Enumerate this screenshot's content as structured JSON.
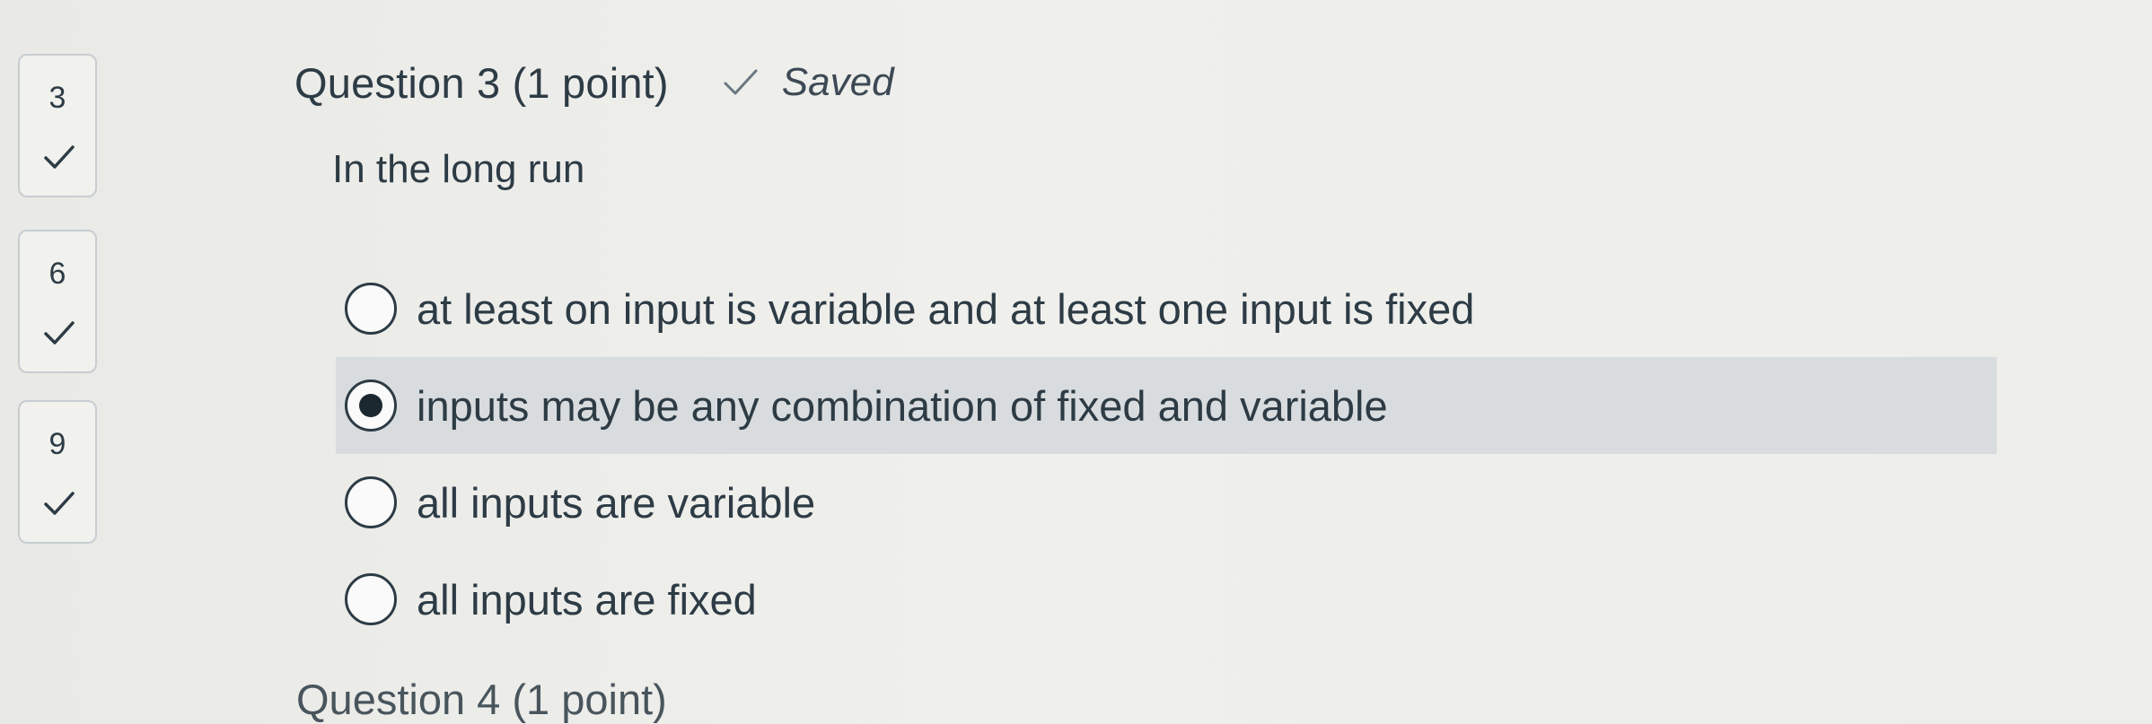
{
  "nav": {
    "items": [
      {
        "number": "3",
        "status": "answered"
      },
      {
        "number": "6",
        "status": "answered"
      },
      {
        "number": "9",
        "status": "answered"
      }
    ]
  },
  "question": {
    "title": "Question 3 (1 point)",
    "saved_label": "Saved",
    "prompt": "In the long run",
    "answers": [
      {
        "label": "at least on input is variable and at least one input is fixed",
        "selected": false
      },
      {
        "label": "inputs may be any combination of fixed and variable",
        "selected": true
      },
      {
        "label": "all inputs are variable",
        "selected": false
      },
      {
        "label": "all inputs are fixed",
        "selected": false
      }
    ]
  },
  "next_question": {
    "title": "Question 4 (1 point)"
  },
  "colors": {
    "text": "#2d3b45",
    "selected_bg": "#d8dcde",
    "border": "#c7cdd1"
  }
}
